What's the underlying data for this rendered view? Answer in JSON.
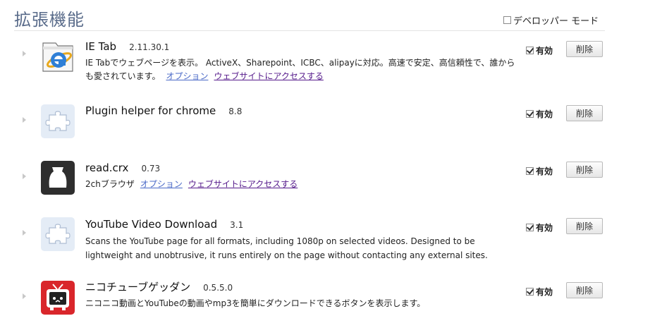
{
  "header": {
    "title": "拡張機能",
    "developer_mode_label": "デベロッパー モード"
  },
  "extensions": [
    {
      "name": "IE Tab",
      "version": "2.11.30.1",
      "description": "IE Tabでウェブページを表示。 ActiveX、Sharepoint、ICBC、alipayに対応。高速で安定、高信頼性で、誰からも愛されています。",
      "options_label": "オプション",
      "website_label": "ウェブサイトにアクセスする",
      "enabled_label": "有効",
      "remove_label": "削除",
      "icon": "ie-tab-icon"
    },
    {
      "name": "Plugin helper for chrome",
      "version": "8.8",
      "enabled_label": "有効",
      "remove_label": "削除",
      "icon": "puzzle-piece-icon"
    },
    {
      "name": "read.crx",
      "version": "0.73",
      "description": "2chブラウザ",
      "options_label": "オプション",
      "website_label": "ウェブサイトにアクセスする",
      "enabled_label": "有効",
      "remove_label": "削除",
      "icon": "read-crx-icon"
    },
    {
      "name": "YouTube Video Download",
      "version": "3.1",
      "description": "Scans the YouTube page for all formats, including 1080p on selected videos. Designed to be lightweight and unobtrusive, it runs entirely on the page without contacting any external sites.",
      "enabled_label": "有効",
      "remove_label": "削除",
      "icon": "puzzle-piece-icon"
    },
    {
      "name": "ニコチューブゲッダン",
      "version": "0.5.5.0",
      "description": "ニコニコ動画とYouTubeの動画やmp3を簡単にダウンロードできるボタンを表示します。",
      "enabled_label": "有効",
      "remove_label": "削除",
      "icon": "niconico-tv-icon"
    }
  ]
}
